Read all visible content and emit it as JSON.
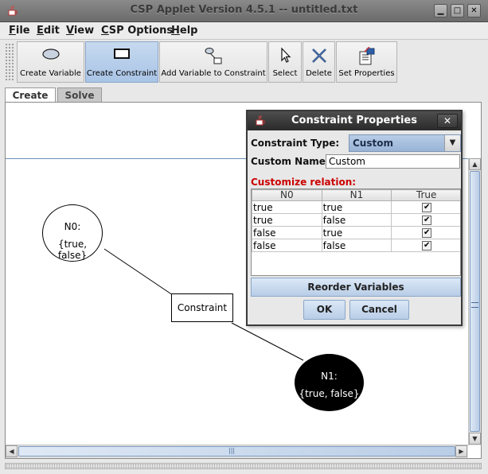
{
  "window": {
    "title": "CSP Applet Version 4.5.1 -- untitled.txt",
    "buttons": {
      "minimize": "▁",
      "maximize": "□",
      "close": "✕"
    }
  },
  "menubar": {
    "items": [
      {
        "key": "F",
        "rest": "ile"
      },
      {
        "key": "E",
        "rest": "dit"
      },
      {
        "key": "V",
        "rest": "iew"
      },
      {
        "key": "C",
        "rest": "SP Options"
      },
      {
        "key": "H",
        "rest": "elp"
      }
    ]
  },
  "toolbar": {
    "tools": [
      {
        "label": "Create Variable",
        "icon": "variable-ellipse-icon",
        "active": false
      },
      {
        "label": "Create Constraint",
        "icon": "constraint-rect-icon",
        "active": true
      },
      {
        "label": "Add Variable to Constraint",
        "icon": "link-icon",
        "active": false
      },
      {
        "label": "Select",
        "icon": "cursor-arrow-icon",
        "active": false
      },
      {
        "label": "Delete",
        "icon": "delete-x-icon",
        "active": false
      },
      {
        "label": "Set Properties",
        "icon": "properties-icon",
        "active": false
      }
    ]
  },
  "tabs": [
    {
      "label": "Create",
      "active": true
    },
    {
      "label": "Solve",
      "active": false
    }
  ],
  "graph": {
    "variables": [
      {
        "name": "N0:",
        "domain": "{true, false}",
        "fill": "#ffffff",
        "text_color": "#000000"
      },
      {
        "name": "N1:",
        "domain": "{true, false}",
        "fill": "#000000",
        "text_color": "#ffffff"
      }
    ],
    "constraint": {
      "label": "Constraint"
    }
  },
  "dialog": {
    "title": "Constraint Properties",
    "close_glyph": "✕",
    "type_label": "Constraint Type:",
    "type_value": "Custom",
    "name_label": "Custom Name:",
    "name_value": "Custom",
    "relation_label": "Customize relation:",
    "relation": {
      "columns": [
        "N0",
        "N1",
        "True"
      ],
      "rows": [
        [
          "true",
          "true",
          true
        ],
        [
          "true",
          "false",
          true
        ],
        [
          "false",
          "true",
          true
        ],
        [
          "false",
          "false",
          true
        ]
      ]
    },
    "reorder_label": "Reorder Variables",
    "ok_label": "OK",
    "cancel_label": "Cancel"
  },
  "scrollbars": {
    "up": "▲",
    "down": "▼",
    "left": "◀",
    "right": "▶",
    "grip": "|||"
  },
  "colors": {
    "accent": "#b8cde6",
    "warning_text": "#cc0000",
    "title_bar": "#2a2a2a"
  }
}
